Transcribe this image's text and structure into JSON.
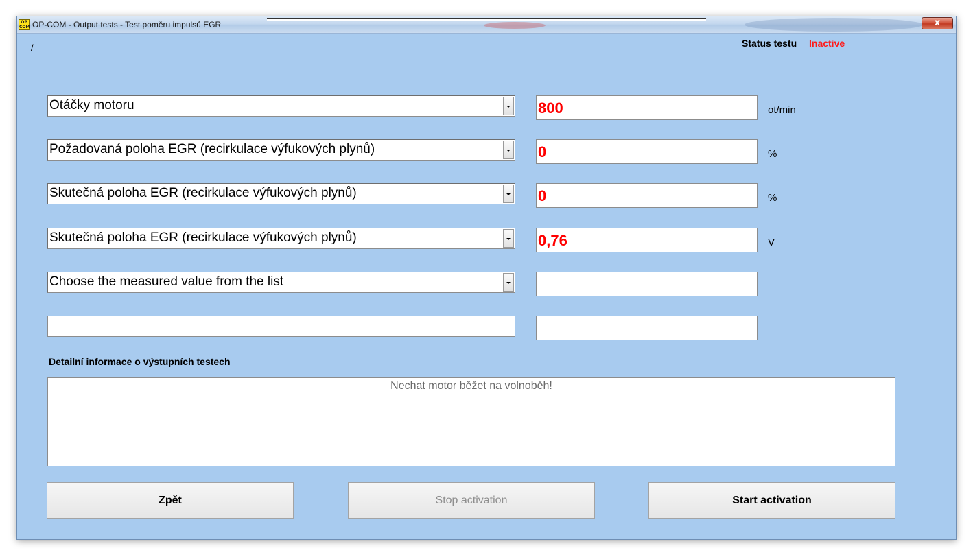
{
  "window": {
    "icon_text_top": "OP",
    "icon_text_bottom": "COM",
    "title": "OP-COM - Output tests - Test poměru impulsů EGR",
    "close_symbol": "x"
  },
  "header": {
    "slash": "/",
    "status_label": "Status testu",
    "status_value": "Inactive"
  },
  "rows": [
    {
      "measure": "Otáčky motoru",
      "value": "800",
      "unit": "ot/min"
    },
    {
      "measure": "Požadovaná poloha EGR (recirkulace výfukových plynů)",
      "value": "0",
      "unit": "%"
    },
    {
      "measure": "Skutečná poloha EGR (recirkulace výfukových plynů)",
      "value": "0",
      "unit": "%"
    },
    {
      "measure": "Skutečná poloha EGR (recirkulace výfukových plynů)",
      "value": "0,76",
      "unit": "V"
    },
    {
      "measure": "Choose the measured value from the list",
      "value": "",
      "unit": ""
    },
    {
      "measure": "",
      "value": "",
      "unit": ""
    }
  ],
  "details": {
    "label": "Detailní informace o výstupních testech",
    "text": "Nechat motor běžet na volnoběh!"
  },
  "buttons": {
    "back": "Zpět",
    "stop": "Stop activation",
    "start": "Start activation"
  },
  "colors": {
    "background": "#a8cbef",
    "status_inactive": "#ff1a1a",
    "value_text": "#ff0000"
  }
}
